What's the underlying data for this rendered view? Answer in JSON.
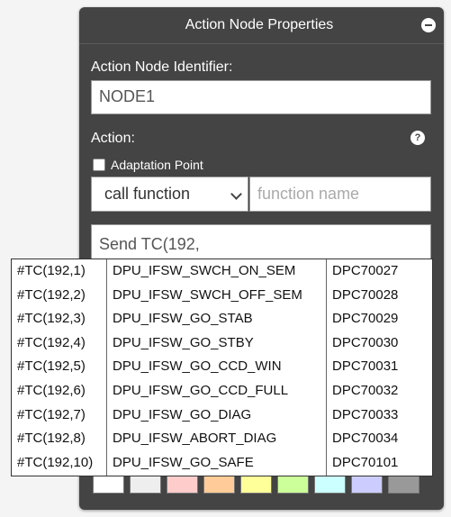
{
  "panel": {
    "title": "Action Node Properties",
    "identifier_label": "Action Node Identifier:",
    "identifier_value": "NODE1",
    "action_label": "Action:",
    "adaptation_label": "Adaptation Point",
    "call_type": "call function",
    "function_placeholder": "function name",
    "action_text_visible": "Send TC(192,",
    "swatches": [
      "#ffffff",
      "#eeeeee",
      "#ffcccc",
      "#ffcc99",
      "#ffff99",
      "#ccff99",
      "#ccffff",
      "#ccccff",
      "#999999"
    ]
  },
  "dropdown": {
    "rows": [
      {
        "tc": "#TC(192,1)",
        "name": "DPU_IFSW_SWCH_ON_SEM",
        "id": "DPC70027"
      },
      {
        "tc": "#TC(192,2)",
        "name": "DPU_IFSW_SWCH_OFF_SEM",
        "id": "DPC70028"
      },
      {
        "tc": "#TC(192,3)",
        "name": "DPU_IFSW_GO_STAB",
        "id": "DPC70029"
      },
      {
        "tc": "#TC(192,4)",
        "name": "DPU_IFSW_GO_STBY",
        "id": "DPC70030"
      },
      {
        "tc": "#TC(192,5)",
        "name": "DPU_IFSW_GO_CCD_WIN",
        "id": "DPC70031"
      },
      {
        "tc": "#TC(192,6)",
        "name": "DPU_IFSW_GO_CCD_FULL",
        "id": "DPC70032"
      },
      {
        "tc": "#TC(192,7)",
        "name": "DPU_IFSW_GO_DIAG",
        "id": "DPC70033"
      },
      {
        "tc": "#TC(192,8)",
        "name": "DPU_IFSW_ABORT_DIAG",
        "id": "DPC70034"
      },
      {
        "tc": "#TC(192,10)",
        "name": "DPU_IFSW_GO_SAFE",
        "id": "DPC70101"
      }
    ]
  }
}
